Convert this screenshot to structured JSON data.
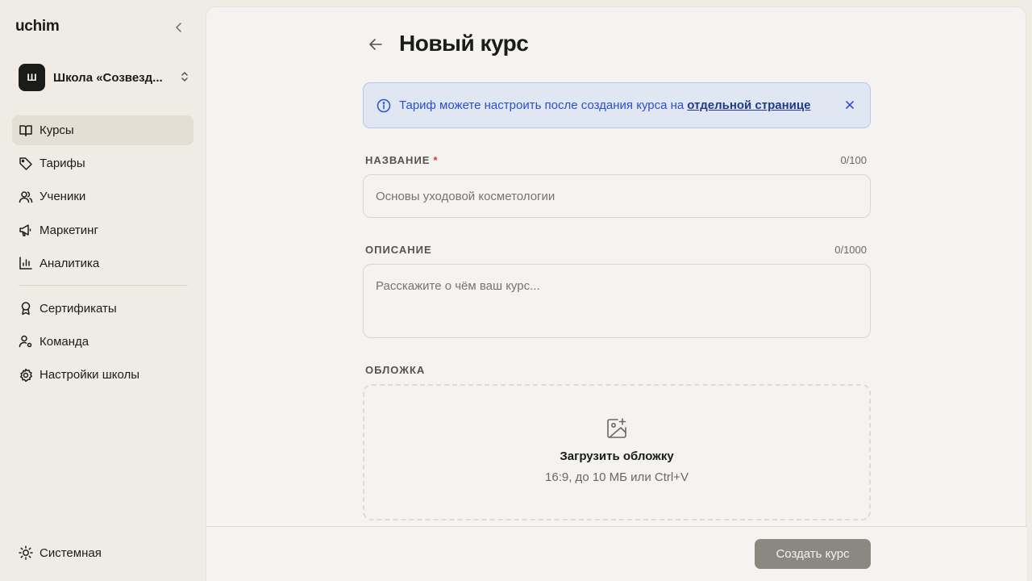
{
  "brand": "uchim",
  "school": {
    "avatar": "Ш",
    "name": "Школа «Созвезд..."
  },
  "nav": {
    "primary": [
      {
        "label": "Курсы",
        "icon": "book-icon",
        "active": true
      },
      {
        "label": "Тарифы",
        "icon": "tag-icon"
      },
      {
        "label": "Ученики",
        "icon": "users-icon"
      },
      {
        "label": "Маркетинг",
        "icon": "megaphone-icon"
      },
      {
        "label": "Аналитика",
        "icon": "bar-chart-icon"
      }
    ],
    "secondary": [
      {
        "label": "Сертификаты",
        "icon": "award-icon"
      },
      {
        "label": "Команда",
        "icon": "user-settings-icon"
      },
      {
        "label": "Настройки школы",
        "icon": "gear-icon"
      }
    ]
  },
  "theme_label": "Системная",
  "page": {
    "title": "Новый курс"
  },
  "alert": {
    "text": "Тариф можете настроить после создания курса на",
    "link": "отдельной странице"
  },
  "form": {
    "name": {
      "label": "НАЗВАНИЕ",
      "required": "*",
      "counter": "0/100",
      "placeholder": "Основы уходовой косметологии",
      "value": ""
    },
    "description": {
      "label": "ОПИСАНИЕ",
      "counter": "0/1000",
      "placeholder": "Расскажите о чём ваш курс...",
      "value": ""
    },
    "cover": {
      "label": "ОБЛОЖКА",
      "title": "Загрузить обложку",
      "hint": "16:9, до 10 МБ или Ctrl+V"
    }
  },
  "footer": {
    "submit_label": "Создать курс"
  },
  "colors": {
    "accent_info": "#2a4fd0",
    "required": "#d9363e",
    "button_disabled": "#8b8882"
  }
}
